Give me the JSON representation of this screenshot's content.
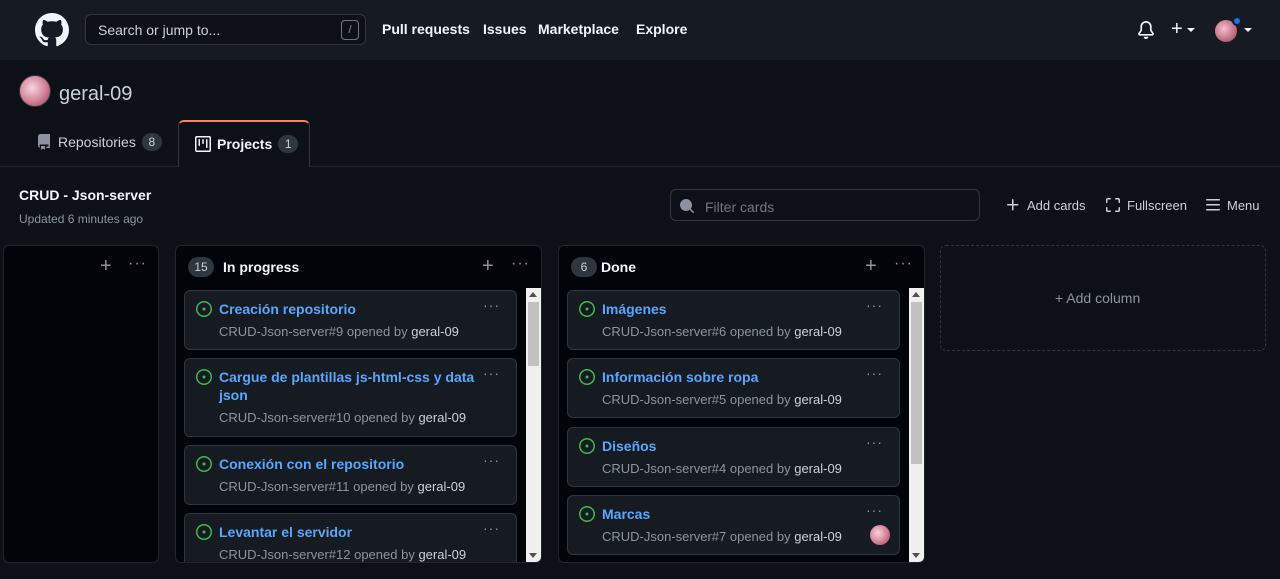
{
  "header": {
    "logo": "github-mark-icon",
    "search_placeholder": "Search or jump to...",
    "search_shortcut": "/",
    "nav": [
      "Pull requests",
      "Issues",
      "Marketplace",
      "Explore"
    ],
    "plus_label": "+"
  },
  "profile": {
    "username": "geral-09"
  },
  "tabs": [
    {
      "label": "Repositories",
      "count": "8",
      "icon": "repo-icon"
    },
    {
      "label": "Projects",
      "count": "1",
      "icon": "project-icon",
      "selected": true
    }
  ],
  "project": {
    "title": "CRUD - Json-server",
    "updated": "Updated 6 minutes ago",
    "filter_placeholder": "Filter cards",
    "add_cards": "Add cards",
    "fullscreen": "Fullscreen",
    "menu": "Menu"
  },
  "columns": [
    {
      "name": "",
      "count": "",
      "cards": []
    },
    {
      "name": "In progress",
      "count": "15",
      "cards": [
        {
          "title": "Creación repositorio",
          "ref": "CRUD-Json-server#9 opened by",
          "author": "geral-09"
        },
        {
          "title": "Cargue de plantillas js-html-css y data json",
          "ref": "CRUD-Json-server#10 opened by",
          "author": "geral-09"
        },
        {
          "title": "Conexión con el repositorio",
          "ref": "CRUD-Json-server#11 opened by",
          "author": "geral-09"
        },
        {
          "title": "Levantar el servidor",
          "ref": "CRUD-Json-server#12 opened by",
          "author": "geral-09"
        }
      ]
    },
    {
      "name": "Done",
      "count": "6",
      "cards": [
        {
          "title": "Imágenes",
          "ref": "CRUD-Json-server#6 opened by",
          "author": "geral-09"
        },
        {
          "title": "Información sobre ropa",
          "ref": "CRUD-Json-server#5 opened by",
          "author": "geral-09"
        },
        {
          "title": "Diseños",
          "ref": "CRUD-Json-server#4 opened by",
          "author": "geral-09"
        },
        {
          "title": "Marcas",
          "ref": "CRUD-Json-server#7 opened by",
          "author": "geral-09"
        }
      ]
    }
  ],
  "add_column_label": "+ Add column",
  "colors": {
    "bg": "#0d1117",
    "header_bg": "#161b22",
    "link": "#58a6ff",
    "open_issue": "#3fb950",
    "tab_accent": "#f78166",
    "notification": "#1f6feb"
  }
}
